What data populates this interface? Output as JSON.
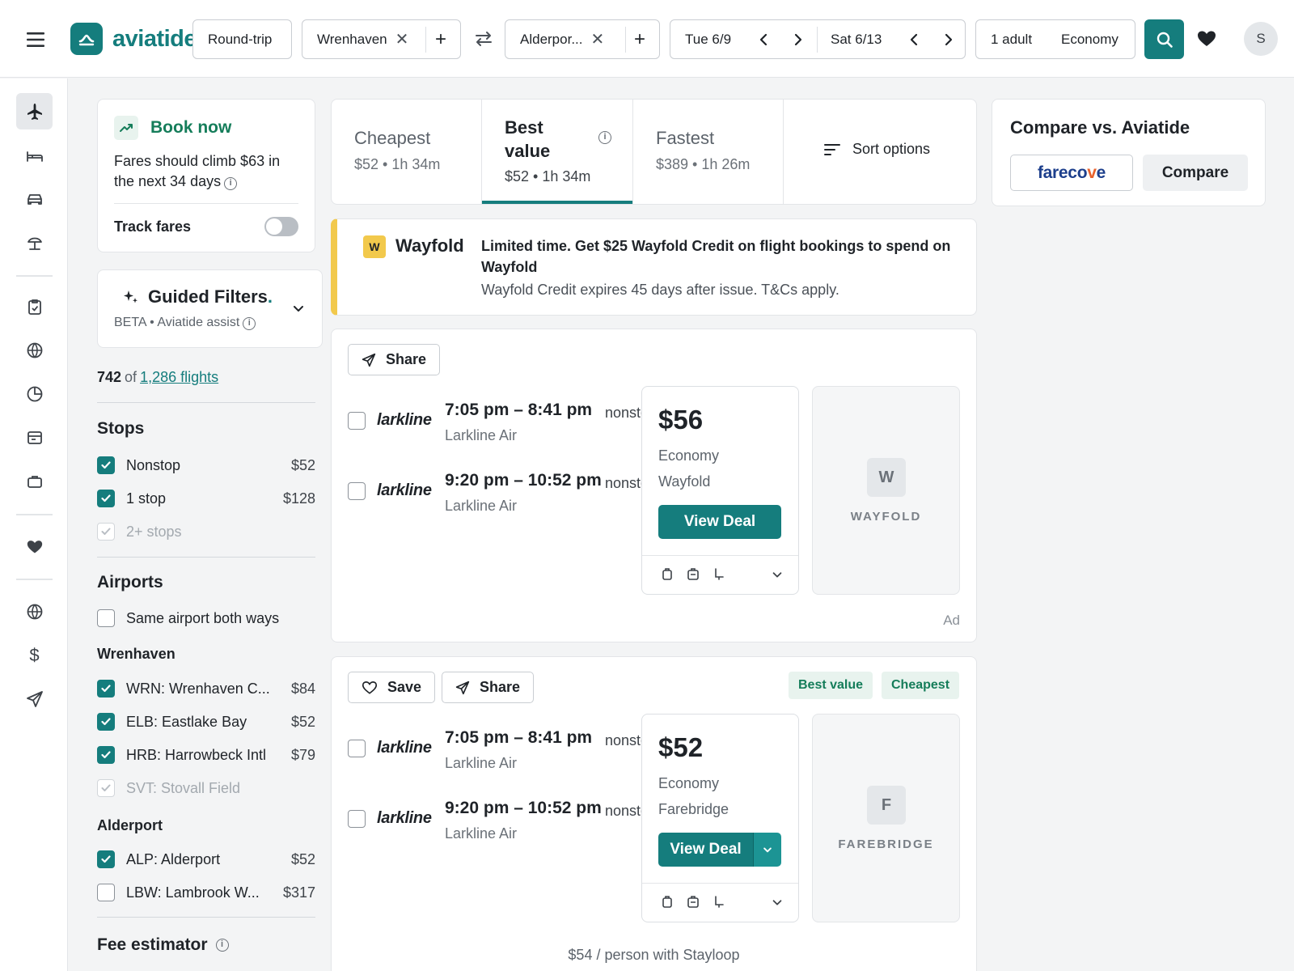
{
  "brand": {
    "name": "aviatide",
    "color": "#157d7d"
  },
  "topbar": {
    "trip_type": "Round-trip",
    "origin": "Wrenhaven",
    "destination": "Alderpor...",
    "depart_date": "Tue 6/9",
    "return_date": "Sat 6/13",
    "travelers": "1 adult",
    "cabin": "Economy",
    "avatar_initial": "S",
    "icons": [
      "hamburger-icon",
      "close-icon",
      "plus-icon",
      "swap-icon",
      "chevron-left-icon",
      "chevron-right-icon",
      "search-icon",
      "heart-icon"
    ]
  },
  "rail": {
    "items": [
      "flights-icon",
      "stays-icon",
      "cars-icon",
      "packages-icon",
      "trips-icon",
      "explore-icon",
      "tracker-icon",
      "deals-icon",
      "business-icon",
      "saved-icon",
      "globe-icon",
      "currency-icon",
      "send-icon"
    ]
  },
  "book_now": {
    "title": "Book now",
    "desc": "Fares should climb $63 in the next 34 days",
    "track_label": "Track fares",
    "track_enabled": false
  },
  "guided_filters": {
    "title": "Guided Filters",
    "title_dot": ".",
    "subtitle": "BETA • Aviatide assist"
  },
  "results_count": {
    "shown": "742",
    "of": "of",
    "total": "1,286 flights"
  },
  "filters": {
    "stops_title": "Stops",
    "stops": [
      {
        "label": "Nonstop",
        "price": "$52",
        "checked": true
      },
      {
        "label": "1 stop",
        "price": "$128",
        "checked": true
      },
      {
        "label": "2+ stops",
        "price": "",
        "checked": true,
        "disabled": true
      }
    ],
    "airports_title": "Airports",
    "same_airport": {
      "label": "Same airport both ways",
      "checked": false
    },
    "origin_group": "Wrenhaven",
    "origin_airports": [
      {
        "label": "WRN: Wrenhaven C...",
        "price": "$84",
        "checked": true
      },
      {
        "label": "ELB: Eastlake Bay",
        "price": "$52",
        "checked": true
      },
      {
        "label": "HRB: Harrowbeck Intl",
        "price": "$79",
        "checked": true
      },
      {
        "label": "SVT: Stovall Field",
        "price": "",
        "checked": true,
        "disabled": true
      }
    ],
    "dest_group": "Alderport",
    "dest_airports": [
      {
        "label": "ALP: Alderport",
        "price": "$52",
        "checked": true
      },
      {
        "label": "LBW: Lambrook W...",
        "price": "$317",
        "checked": false
      }
    ],
    "fee_title": "Fee estimator"
  },
  "sort_tabs": [
    {
      "name": "Cheapest",
      "meta": "$52 • 1h 34m",
      "active": false
    },
    {
      "name": "Best value",
      "meta": "$52 • 1h 34m",
      "active": true
    },
    {
      "name": "Fastest",
      "meta": "$389 • 1h 26m",
      "active": false
    }
  ],
  "sort_options_label": "Sort options",
  "compare": {
    "title": "Compare vs. Aviatide",
    "partner": "farecove",
    "partner_a": "fareco",
    "partner_b": "v",
    "partner_c": "e",
    "button": "Compare"
  },
  "promo": {
    "badge": "W",
    "brand": "Wayfold",
    "headline": "Limited time. Get $25 Wayfold Credit on flight bookings to spend on Wayfold",
    "sub": "Wayfold Credit expires 45 days after issue. T&Cs apply.",
    "accent": "#f2c94c"
  },
  "results": [
    {
      "share_label": "Share",
      "legs": [
        {
          "airline_logo": "larkline",
          "time": "7:05 pm – 8:41 pm",
          "airline": "Larkline Air",
          "stops": "nonstop"
        },
        {
          "airline_logo": "larkline",
          "time": "9:20 pm – 10:52 pm",
          "airline": "Larkline Air",
          "stops": "nonstop"
        }
      ],
      "price": "$56",
      "cabin": "Economy",
      "provider": "Wayfold",
      "cta": "View Deal",
      "tile_letter": "W",
      "tile_name": "WAYFOLD",
      "ad_label": "Ad"
    },
    {
      "save_label": "Save",
      "share_label": "Share",
      "tags": [
        "Best value",
        "Cheapest"
      ],
      "legs": [
        {
          "airline_logo": "larkline",
          "time": "7:05 pm – 8:41 pm",
          "airline": "Larkline Air",
          "stops": "nonstop"
        },
        {
          "airline_logo": "larkline",
          "time": "9:20 pm – 10:52 pm",
          "airline": "Larkline Air",
          "stops": "nonstop"
        }
      ],
      "price": "$52",
      "cabin": "Economy",
      "provider": "Farebridge",
      "cta": "View Deal",
      "tile_letter": "F",
      "tile_name": "FAREBRIDGE",
      "stayloop_note": "$54 / person with Stayloop"
    }
  ]
}
